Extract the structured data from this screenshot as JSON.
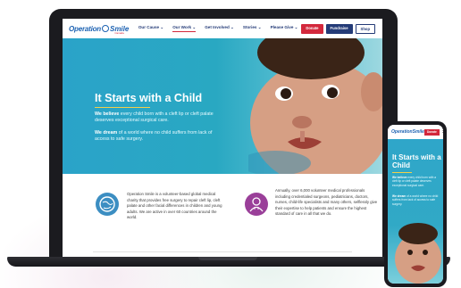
{
  "site": {
    "logo_word": "Operation",
    "logo_smile": "Smile",
    "logo_sub": "Canada",
    "nav": [
      {
        "label": "Our Cause ⌄"
      },
      {
        "label": "Our Work ⌄"
      },
      {
        "label": "Get Involved ⌄"
      },
      {
        "label": "Stories ⌄"
      },
      {
        "label": "Please Give ⌄"
      }
    ],
    "buttons": {
      "donate": "Donate",
      "fundraise": "Fundraise",
      "shop": "Shop"
    }
  },
  "hero": {
    "title": "It Starts with a Child",
    "p1_bold": "We believe",
    "p1_rest": " every child born with a cleft lip or cleft palate deserves exceptional surgical care.",
    "p2_bold": "We dream",
    "p2_rest": " of a world where no child suffers from lack of access to safe surgery."
  },
  "info": {
    "left": "Operation Smile is a volunteer-based global medical charity that provides free surgery to repair cleft lip, cleft palate and other facial differences in children and young adults. We are active in over 60 countries around the world.",
    "right": "Annually, over 6,000 volunteer medical professionals including credentialed surgeons, pediatricians, doctors, nurses, child-life specialists and many others, selflessly give their expertise to help patients and ensure the highest standard of care in all that we do.",
    "icon_left": "globe-hands-icon",
    "icon_right": "doctor-icon"
  },
  "phone": {
    "logo": "OperationSmile",
    "donate": "Donate",
    "menu": "☰",
    "title": "It Starts with a Child",
    "p1_bold": "We believe",
    "p1_rest": " every child born with a cleft lip or cleft palate deserves exceptional surgical care.",
    "p2_bold": "We dream",
    "p2_rest": " of a world where no child suffers from lack of access to safe surgery."
  },
  "colors": {
    "brand_blue": "#1e63b3",
    "navy": "#243b77",
    "red": "#d3283c",
    "teal": "#2aa3c9",
    "purple": "#9a3f99"
  }
}
